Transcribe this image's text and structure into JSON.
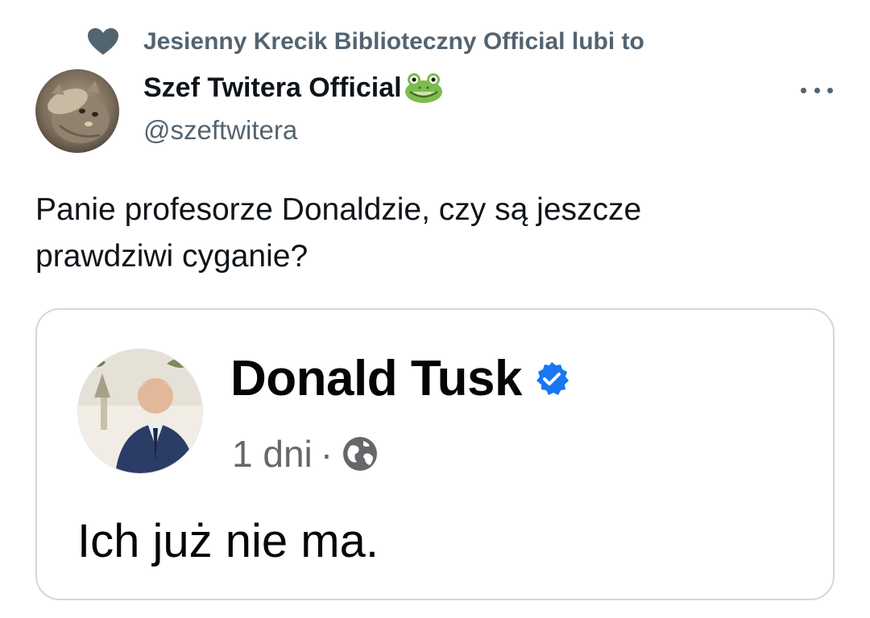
{
  "social_context": {
    "text": "Jesienny Krecik Biblioteczny Official lubi to",
    "icon": "heart-icon"
  },
  "author": {
    "name": "Szef Twitera Official",
    "name_emoji": "frog-icon",
    "handle": "@szeftwitera",
    "avatar": "cat-saluting-avatar"
  },
  "menu": {
    "icon": "more-icon"
  },
  "tweet": {
    "text_line1": "Panie profesorze Donaldzie, czy są jeszcze",
    "text_line2": "prawdziwi cyganie?"
  },
  "embedded_post": {
    "author_name": "Donald Tusk",
    "verified": true,
    "time": "1 dni",
    "separator": "·",
    "audience_icon": "globe-icon",
    "text": "Ich już nie ma."
  },
  "colors": {
    "primary_text": "#0f1419",
    "secondary_text": "#536471",
    "card_border": "#cfd9de",
    "verified_blue": "#1877f2",
    "fb_secondary": "#65676b"
  }
}
